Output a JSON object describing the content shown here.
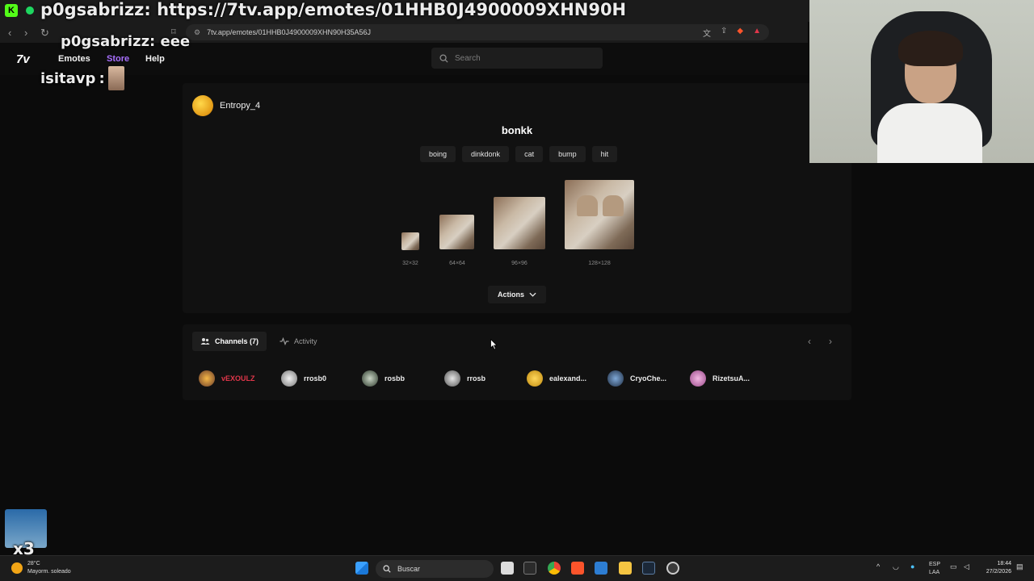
{
  "browser": {
    "url": "7tv.app/emotes/01HHB0J4900009XHN90H35A56J",
    "tab_icon_letter": "K"
  },
  "chat_overlay": {
    "line1_user": "p0gsabrizz",
    "line1_text": ": https://7tv.app/emotes/01HHB0J4900009XHN90H",
    "line2_user": "p0gsabrizz",
    "line2_text": ": eee",
    "line3_user": "isitavp",
    "line3_text": ":",
    "bottom_badge": "x3"
  },
  "site_nav": {
    "logo": "7v",
    "links": [
      "Emotes",
      "Store",
      "Help"
    ],
    "active_link_color": "#a970ff",
    "search_placeholder": "Search"
  },
  "emote": {
    "owner": "Entropy_4",
    "name": "bonkk",
    "tags": [
      "boing",
      "dinkdonk",
      "cat",
      "bump",
      "hit"
    ],
    "sizes": [
      "32×32",
      "64×64",
      "96×96",
      "128×128"
    ],
    "actions_label": "Actions"
  },
  "channels_panel": {
    "tab_channels": "Channels (7)",
    "tab_activity": "Activity",
    "channels": [
      {
        "name": "vEXOULZ",
        "color": "#e0364a"
      },
      {
        "name": "rrosb0",
        "color": "#ececec"
      },
      {
        "name": "rosbb",
        "color": "#ececec"
      },
      {
        "name": "rrosb",
        "color": "#ececec"
      },
      {
        "name": "ealexand...",
        "color": "#ececec"
      },
      {
        "name": "CryoChe...",
        "color": "#ececec"
      },
      {
        "name": "RizetsuA...",
        "color": "#ececec"
      }
    ]
  },
  "taskbar": {
    "weather_temp": "28°C",
    "weather_desc": "Mayorm. soleado",
    "search_label": "Buscar",
    "lang_top": "ESP",
    "lang_bottom": "LAA",
    "time": "18:44",
    "date": "27/2/2026"
  }
}
